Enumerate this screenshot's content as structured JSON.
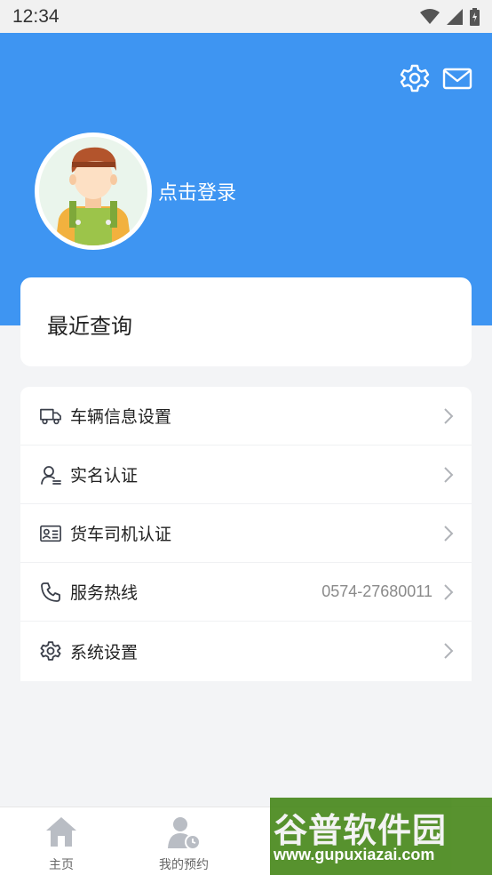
{
  "status_bar": {
    "time": "12:34"
  },
  "profile": {
    "login_label": "点击登录"
  },
  "recent": {
    "title": "最近查询"
  },
  "menu": {
    "items": [
      {
        "label": "车辆信息设置",
        "icon": "truck-icon",
        "value": ""
      },
      {
        "label": "实名认证",
        "icon": "user-verify-icon",
        "value": ""
      },
      {
        "label": "货车司机认证",
        "icon": "id-card-icon",
        "value": ""
      },
      {
        "label": "服务热线",
        "icon": "phone-icon",
        "value": "0574-27680011"
      },
      {
        "label": "系统设置",
        "icon": "gear-icon",
        "value": ""
      }
    ]
  },
  "bottom_nav": {
    "items": [
      {
        "label": "主页",
        "icon": "home-icon"
      },
      {
        "label": "我的预约",
        "icon": "appointment-icon"
      }
    ]
  },
  "watermark": {
    "main": "谷普软件园",
    "url": "www.gupuxiazai.com"
  },
  "colors": {
    "accent": "#3e95f2",
    "background": "#f3f4f6"
  }
}
